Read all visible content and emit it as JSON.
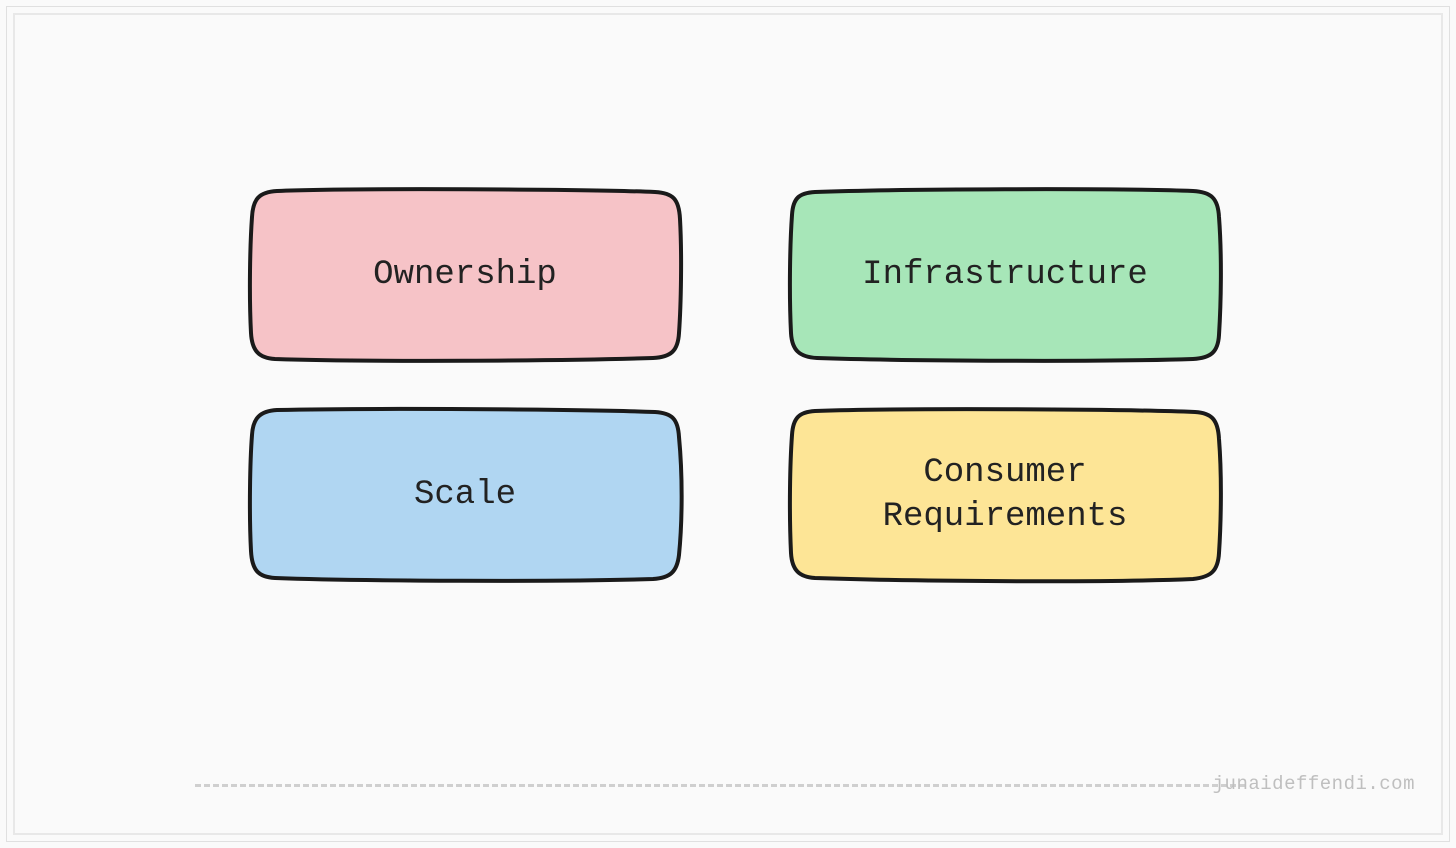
{
  "boxes": {
    "top_left": {
      "label": "Ownership",
      "fill": "#f6c3c7"
    },
    "top_right": {
      "label": "Infrastructure",
      "fill": "#a7e6b8"
    },
    "bottom_left": {
      "label": "Scale",
      "fill": "#b0d6f2"
    },
    "bottom_right": {
      "label": "Consumer\nRequirements",
      "fill": "#fde596"
    }
  },
  "footer": {
    "attribution": "junaideffendi.com"
  }
}
